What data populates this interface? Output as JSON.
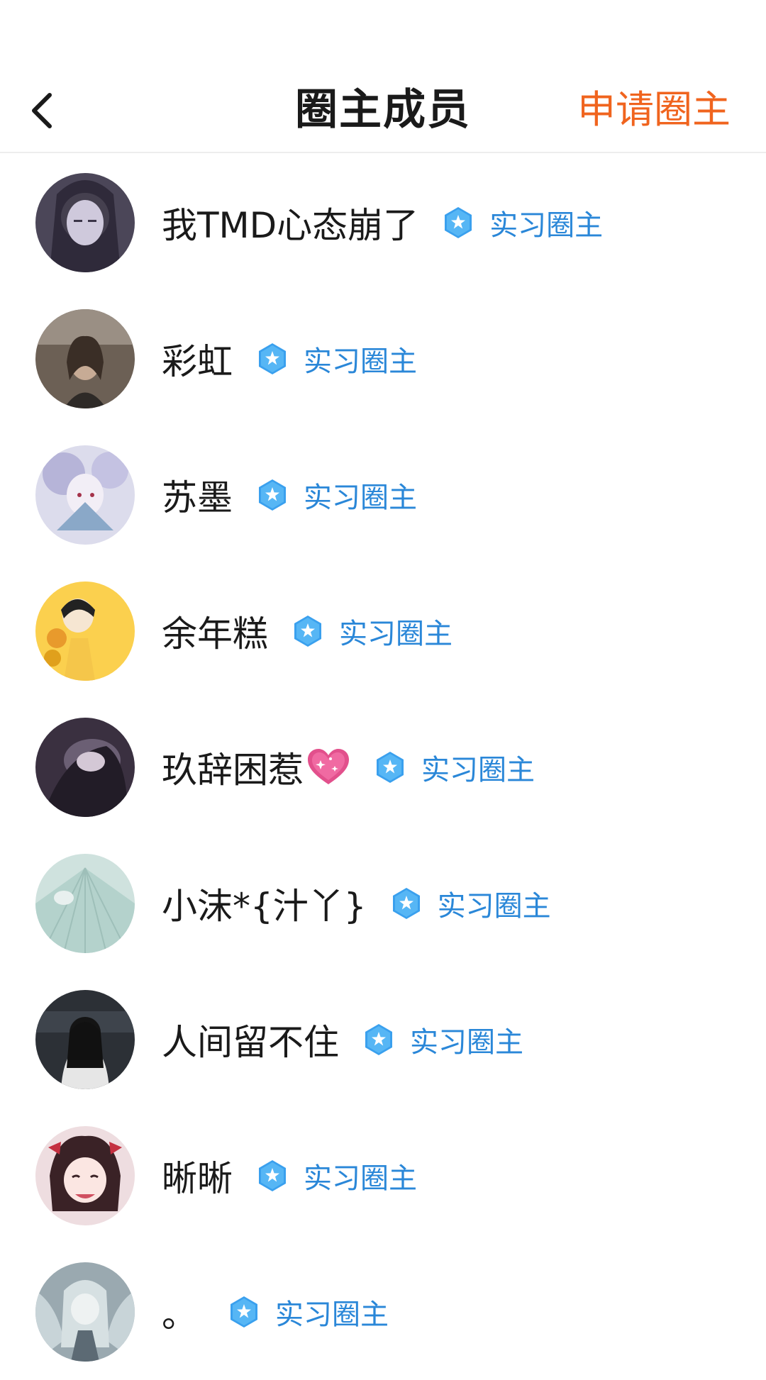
{
  "header": {
    "title": "圈主成员",
    "apply_label": "申请圈主"
  },
  "role_color": "#2a87d8",
  "accent_color": "#f0641e",
  "members": [
    {
      "name": "我TMD心态崩了",
      "role": "实习圈主"
    },
    {
      "name": "彩虹",
      "role": "实习圈主"
    },
    {
      "name": "苏墨",
      "role": "实习圈主"
    },
    {
      "name": "余年糕",
      "role": "实习圈主"
    },
    {
      "name": "玖辞困惹",
      "role": "实习圈主",
      "emoji": "sparkling-heart-icon"
    },
    {
      "name": "小沫*{汁丫}",
      "role": "实习圈主"
    },
    {
      "name": "人间留不住",
      "role": "实习圈主"
    },
    {
      "name": "晰晰",
      "role": "实习圈主"
    },
    {
      "name": "。",
      "role": "实习圈主"
    }
  ]
}
